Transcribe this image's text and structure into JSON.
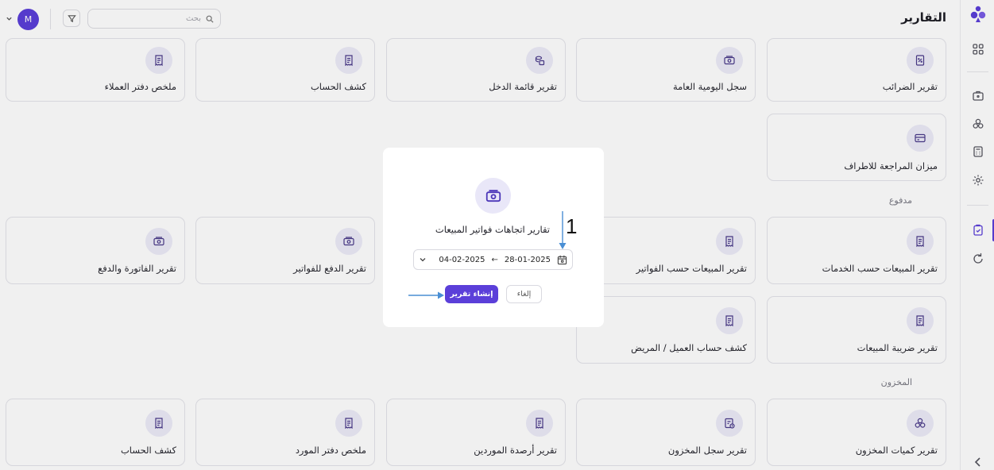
{
  "header": {
    "title": "التقارير",
    "search_placeholder": "بحث",
    "avatar_initial": "M"
  },
  "sections": {
    "paid": "مدفوع",
    "inventory": "المخزون"
  },
  "cards": {
    "row1": [
      "تقرير الضرائب",
      "سجل اليومية العامة",
      "تقرير قائمة الدخل",
      "كشف الحساب",
      "ملخص دفتر العملاء"
    ],
    "row2": [
      "ميزان المراجعة للاطراف"
    ],
    "row3": [
      "تقرير المبيعات حسب الخدمات",
      "تقرير المبيعات حسب الفواتير",
      "تقرير الدفع للفواتير",
      "تقرير الفاتورة والدفع"
    ],
    "row4": [
      "تقرير ضريبة المبيعات",
      "كشف حساب العميل / المريض"
    ],
    "row5": [
      "تقرير كميات المخزون",
      "تقرير سجل المخزون",
      "تقرير أرصدة الموردين",
      "ملخص دفتر المورد",
      "كشف الحساب"
    ]
  },
  "modal": {
    "title": "تقارير اتجاهات فواتير المبيعات",
    "date_from": "28-01-2025",
    "arrow": "←",
    "date_to": "04-02-2025",
    "generate_label": "إنشاء تقرير",
    "cancel_label": "إلغاء"
  },
  "annotation": {
    "number": "1",
    "color": "#4a8fd4"
  },
  "colors": {
    "accent": "#5b3fd9",
    "icon_bg": "#ecebf8"
  }
}
